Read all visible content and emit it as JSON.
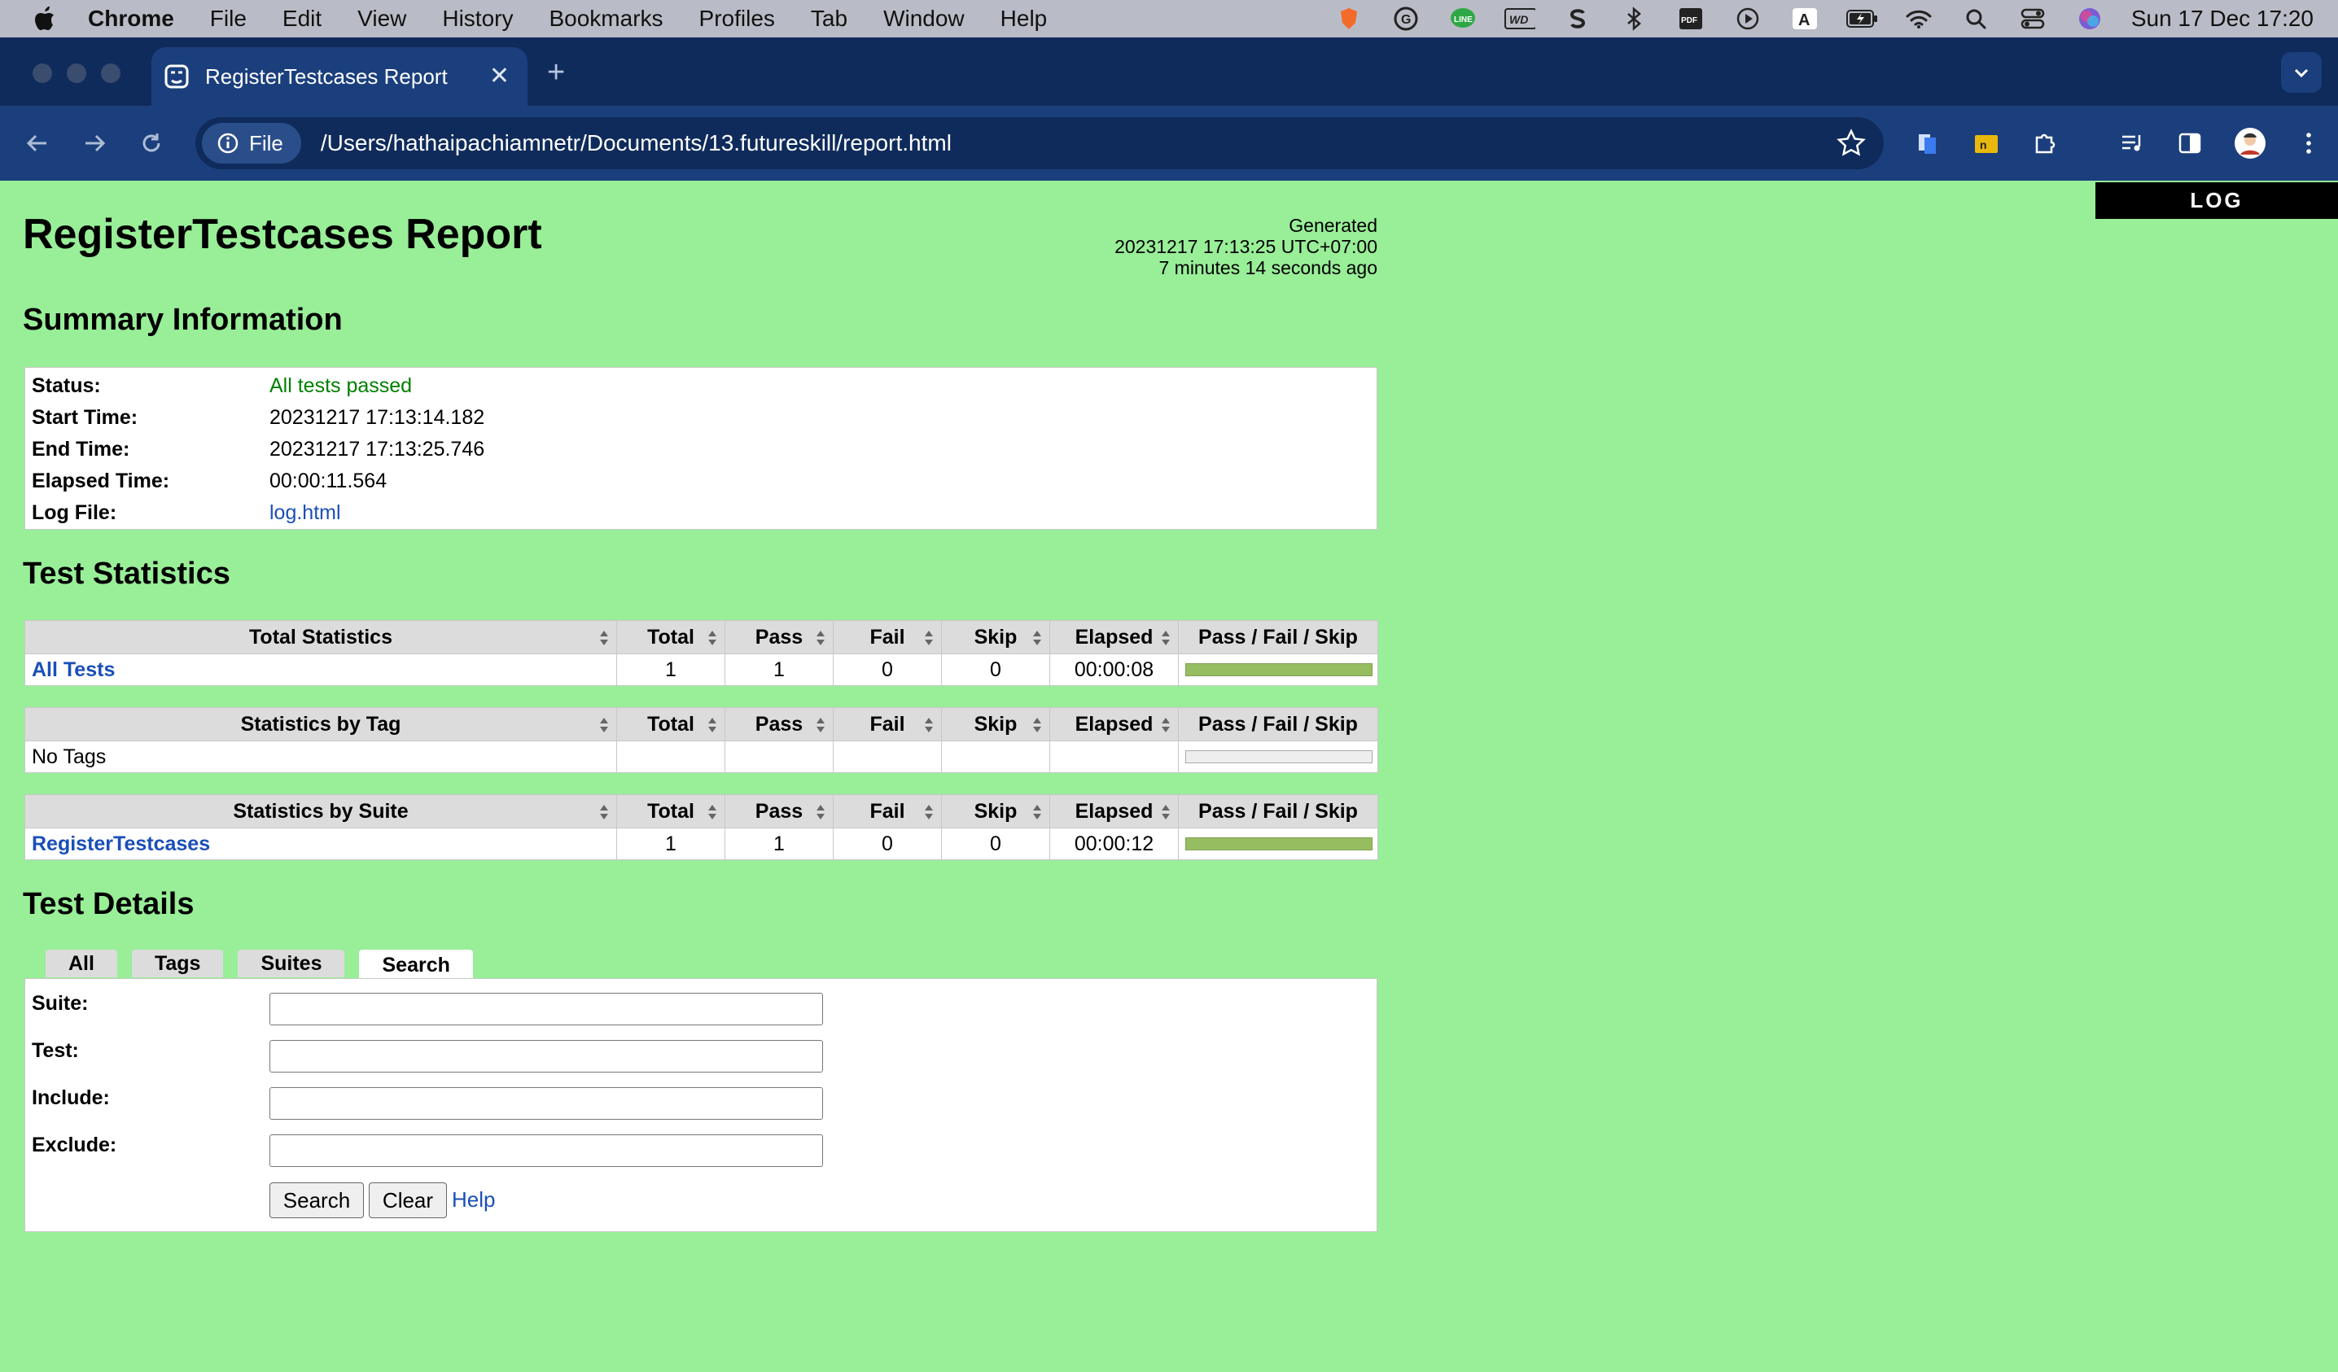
{
  "menubar": {
    "app": "Chrome",
    "items": [
      "File",
      "Edit",
      "View",
      "History",
      "Bookmarks",
      "Profiles",
      "Tab",
      "Window",
      "Help"
    ],
    "status_icons": [
      "brave-icon",
      "grammarly-icon",
      "line-icon",
      "wd-icon",
      "s-icon",
      "bluetooth-icon",
      "pdf-icon",
      "play-icon",
      "input-a-icon",
      "battery-icon",
      "wifi-icon",
      "spotlight-icon",
      "control-center-icon",
      "siri-icon"
    ],
    "clock": "Sun 17 Dec  17:20"
  },
  "browser": {
    "tab_title": "RegisterTestcases Report",
    "chip_label": "File",
    "url": "/Users/hathaipachiamnetr/Documents/13.futureskill/report.html"
  },
  "report": {
    "log_tab": "LOG",
    "title": "RegisterTestcases Report",
    "generated": {
      "label": "Generated",
      "timestamp": "20231217 17:13:25 UTC+07:00",
      "ago": "7 minutes 14 seconds ago"
    },
    "summary": {
      "heading": "Summary Information",
      "rows": [
        {
          "key": "Status:",
          "value": "All tests passed"
        },
        {
          "key": "Start Time:",
          "value": "20231217 17:13:14.182"
        },
        {
          "key": "End Time:",
          "value": "20231217 17:13:25.746"
        },
        {
          "key": "Elapsed Time:",
          "value": "00:00:11.564"
        },
        {
          "key": "Log File:",
          "value": "log.html"
        }
      ]
    },
    "statistics": {
      "heading": "Test Statistics",
      "columns": [
        "Total",
        "Pass",
        "Fail",
        "Skip",
        "Elapsed",
        "Pass / Fail / Skip"
      ],
      "tables": [
        {
          "title": "Total Statistics",
          "rows": [
            {
              "name": "All Tests",
              "total": "1",
              "pass": "1",
              "fail": "0",
              "skip": "0",
              "elapsed": "00:00:08",
              "pass_fraction": 1
            }
          ]
        },
        {
          "title": "Statistics by Tag",
          "rows": [
            {
              "name": "No Tags",
              "total": "",
              "pass": "",
              "fail": "",
              "skip": "",
              "elapsed": "",
              "pass_fraction": 0
            }
          ]
        },
        {
          "title": "Statistics by Suite",
          "rows": [
            {
              "name": "RegisterTestcases",
              "total": "1",
              "pass": "1",
              "fail": "0",
              "skip": "0",
              "elapsed": "00:00:12",
              "pass_fraction": 1
            }
          ]
        }
      ]
    },
    "details": {
      "heading": "Test Details",
      "tabs": [
        "All",
        "Tags",
        "Suites",
        "Search"
      ],
      "active_tab": "Search",
      "fields": [
        {
          "label": "Suite:",
          "value": ""
        },
        {
          "label": "Test:",
          "value": ""
        },
        {
          "label": "Include:",
          "value": ""
        },
        {
          "label": "Exclude:",
          "value": ""
        }
      ],
      "search_button": "Search",
      "clear_button": "Clear",
      "help_link": "Help"
    }
  },
  "colors": {
    "page_background": "#99ee98",
    "pass_bar": "#97bd61",
    "link": "#1a4fb8",
    "status_pass": "#008000"
  }
}
